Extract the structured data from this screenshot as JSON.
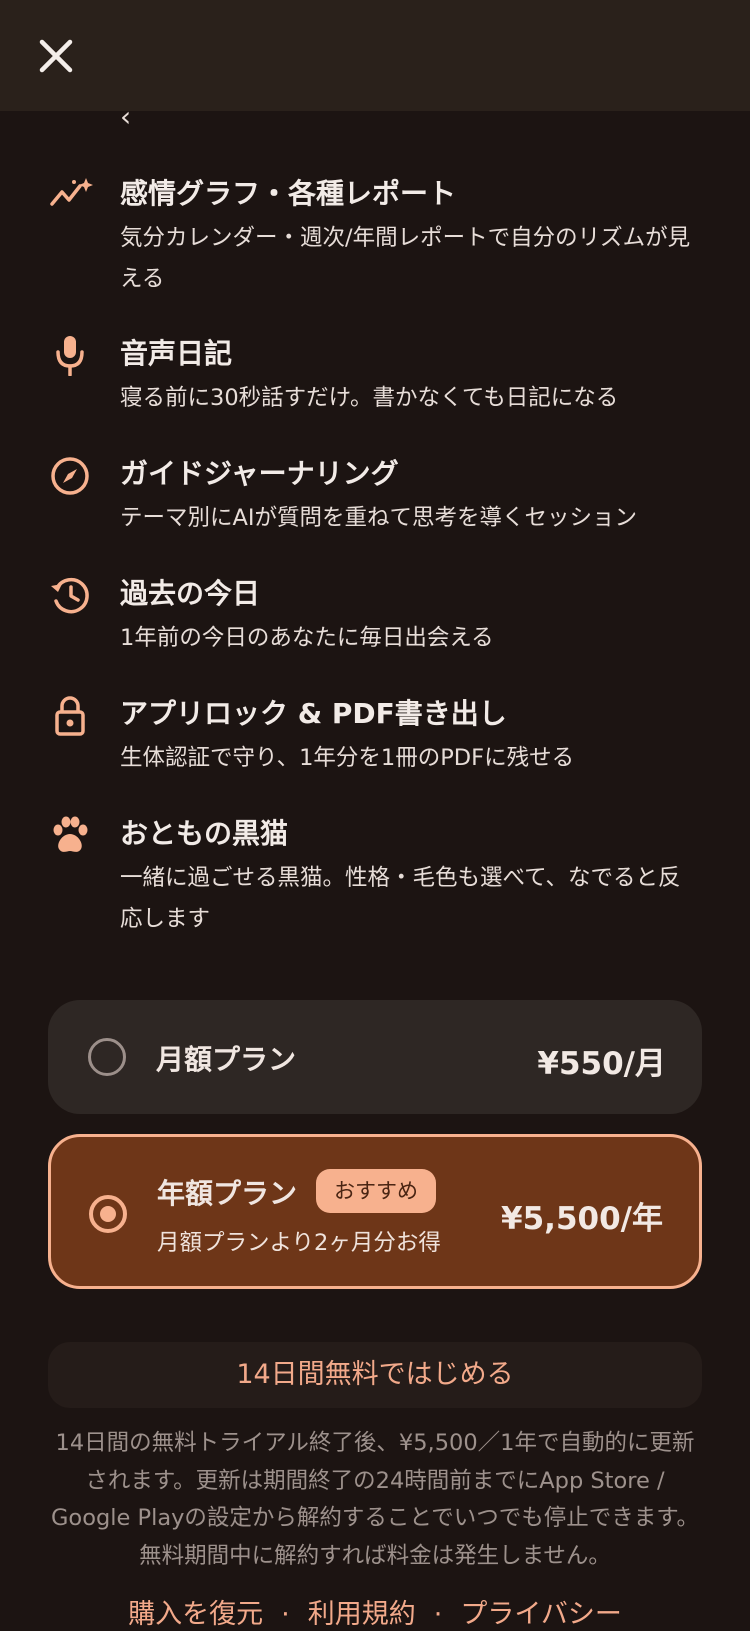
{
  "header": {
    "close_icon": "close-icon",
    "back_icon": "chevron-left-icon",
    "back_text": "‹"
  },
  "features": [
    {
      "icon": "sparkle-chart-icon",
      "title": "感情グラフ・各種レポート",
      "desc": "気分カレンダー・週次/年間レポートで自分のリズムが見える"
    },
    {
      "icon": "microphone-icon",
      "title": "音声日記",
      "desc": "寝る前に30秒話すだけ。書かなくても日記になる"
    },
    {
      "icon": "compass-icon",
      "title": "ガイドジャーナリング",
      "desc": "テーマ別にAIが質問を重ねて思考を導くセッション"
    },
    {
      "icon": "history-icon",
      "title": "過去の今日",
      "desc": "1年前の今日のあなたに毎日出会える"
    },
    {
      "icon": "lock-icon",
      "title": "アプリロック & PDF書き出し",
      "desc": "生体認証で守り、1年分を1冊のPDFに残せる"
    },
    {
      "icon": "paw-icon",
      "title": "おともの黒猫",
      "desc": "一緒に過ごせる黒猫。性格・毛色も選べて、なでると反応します"
    }
  ],
  "plans": {
    "monthly": {
      "name": "月額プラン",
      "price": "¥550/月",
      "selected": false
    },
    "yearly": {
      "name": "年額プラン",
      "badge": "おすすめ",
      "subtitle": "月額プランより2ヶ月分お得",
      "price": "¥5,500/年",
      "selected": true
    }
  },
  "cta": {
    "label": "14日間無料ではじめる"
  },
  "legal": "14日間の無料トライアル終了後、¥5,500／1年で自動的に更新されます。更新は期間終了の24時間前までにApp Store / Google Playの設定から解約することでいつでも停止できます。無料期間中に解約すれば料金は発生しません。",
  "footer": {
    "restore": "購入を復元",
    "terms": "利用規約",
    "privacy": "プライバシー",
    "separator": "·"
  },
  "colors": {
    "background": "#1c1412",
    "accent": "#f7b18e",
    "selected_plan_bg": "#6e3618"
  }
}
